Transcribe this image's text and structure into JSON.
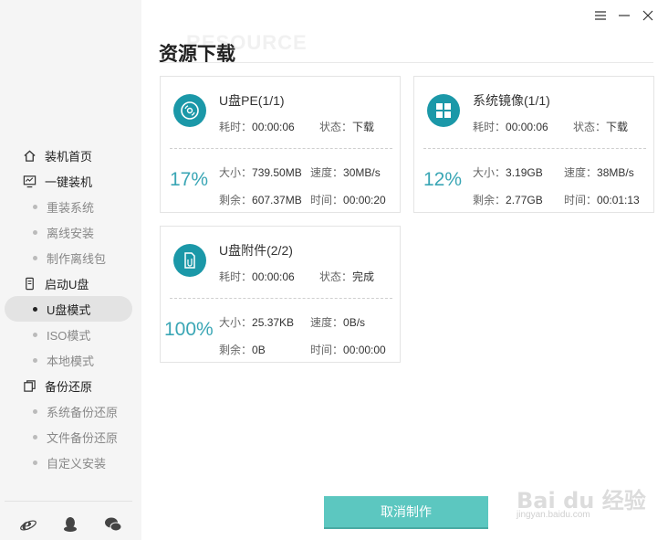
{
  "window": {
    "controls": [
      "menu",
      "minimize",
      "close"
    ]
  },
  "header": {
    "watermark": "RESOURCE",
    "title": "资源下载"
  },
  "sidebar": {
    "items": [
      {
        "label": "装机首页",
        "icon": "home-icon",
        "type": "main"
      },
      {
        "label": "一键装机",
        "icon": "monitor-icon",
        "type": "main"
      },
      {
        "label": "重装系统",
        "type": "sub"
      },
      {
        "label": "离线安装",
        "type": "sub"
      },
      {
        "label": "制作离线包",
        "type": "sub"
      },
      {
        "label": "启动U盘",
        "icon": "usb-icon",
        "type": "main"
      },
      {
        "label": "U盘模式",
        "type": "sub",
        "active": true
      },
      {
        "label": "ISO模式",
        "type": "sub"
      },
      {
        "label": "本地模式",
        "type": "sub"
      },
      {
        "label": "备份还原",
        "icon": "backup-icon",
        "type": "main"
      },
      {
        "label": "系统备份还原",
        "type": "sub"
      },
      {
        "label": "文件备份还原",
        "type": "sub"
      },
      {
        "label": "自定义安装",
        "type": "sub"
      }
    ],
    "bottom_icons": [
      "ie-icon",
      "qq-icon",
      "wechat-icon"
    ]
  },
  "downloads": [
    {
      "name": "U盘PE(1/1)",
      "icon": "disc-icon",
      "elapsed_label": "耗时：",
      "elapsed": "00:00:06",
      "status_label": "状态：",
      "status": "下载",
      "percent": "17%",
      "size_label": "大小：",
      "size": "739.50MB",
      "speed_label": "速度：",
      "speed": "30MB/s",
      "remain_label": "剩余：",
      "remain": "607.37MB",
      "time_label": "时间：",
      "time": "00:00:20"
    },
    {
      "name": "系统镜像(1/1)",
      "icon": "windows-icon",
      "elapsed_label": "耗时：",
      "elapsed": "00:00:06",
      "status_label": "状态：",
      "status": "下载",
      "percent": "12%",
      "size_label": "大小：",
      "size": "3.19GB",
      "speed_label": "速度：",
      "speed": "38MB/s",
      "remain_label": "剩余：",
      "remain": "2.77GB",
      "time_label": "时间：",
      "time": "00:01:13"
    },
    {
      "name": "U盘附件(2/2)",
      "icon": "attachment-file-icon",
      "elapsed_label": "耗时：",
      "elapsed": "00:00:06",
      "status_label": "状态：",
      "status": "完成",
      "percent": "100%",
      "size_label": "大小：",
      "size": "25.37KB",
      "speed_label": "速度：",
      "speed": "0B/s",
      "remain_label": "剩余：",
      "remain": "0B",
      "time_label": "时间：",
      "time": "00:00:00"
    }
  ],
  "actions": {
    "cancel_label": "取消制作"
  },
  "watermark_brand": {
    "line1": "Bai du 经验",
    "line2": "jingyan.baidu.com"
  },
  "colors": {
    "accent": "#1b98a8",
    "percent": "#3aa6b5",
    "button": "#5cc7c0"
  }
}
